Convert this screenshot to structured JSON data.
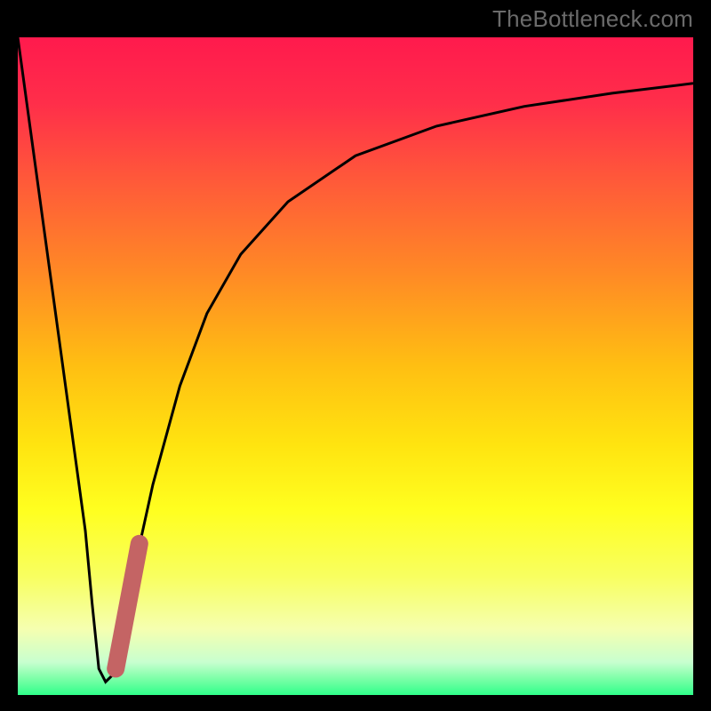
{
  "watermark": "TheBottleneck.com",
  "colors": {
    "frame": "#000000",
    "curve": "#000000",
    "marker": "#c46464",
    "gradient_stops": [
      {
        "offset": 0.0,
        "color": "#ff1a4d"
      },
      {
        "offset": 0.1,
        "color": "#ff2e4a"
      },
      {
        "offset": 0.22,
        "color": "#ff5a39"
      },
      {
        "offset": 0.36,
        "color": "#ff8a25"
      },
      {
        "offset": 0.5,
        "color": "#ffbf12"
      },
      {
        "offset": 0.62,
        "color": "#ffe410"
      },
      {
        "offset": 0.72,
        "color": "#ffff20"
      },
      {
        "offset": 0.82,
        "color": "#f8ff60"
      },
      {
        "offset": 0.9,
        "color": "#f5ffb0"
      },
      {
        "offset": 0.95,
        "color": "#c8ffcf"
      },
      {
        "offset": 0.975,
        "color": "#7dffa8"
      },
      {
        "offset": 1.0,
        "color": "#2fff8a"
      }
    ]
  },
  "chart_data": {
    "type": "line",
    "title": "",
    "xlabel": "",
    "ylabel": "",
    "xlim": [
      0,
      100
    ],
    "ylim": [
      0,
      100
    ],
    "series": [
      {
        "name": "bottleneck-curve",
        "x": [
          0,
          2,
          4,
          6,
          8,
          10,
          11,
          12,
          13,
          14,
          15,
          17,
          20,
          24,
          28,
          33,
          40,
          50,
          62,
          75,
          88,
          100
        ],
        "y": [
          100,
          85,
          70,
          55,
          40,
          25,
          14,
          4,
          2,
          3,
          8,
          18,
          32,
          47,
          58,
          67,
          75,
          82,
          86.5,
          89.5,
          91.5,
          93
        ]
      }
    ],
    "marker": {
      "name": "highlight-segment",
      "x": [
        14.5,
        18.0
      ],
      "y": [
        4,
        23
      ]
    }
  }
}
